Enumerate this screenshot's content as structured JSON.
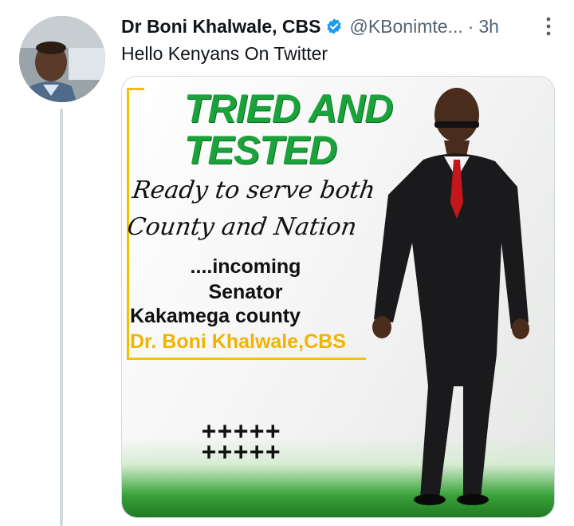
{
  "tweet": {
    "author_name": "Dr Boni Khalwale, CBS",
    "handle": "@KBonimte...",
    "separator": "·",
    "time": "3h",
    "text": "Hello Kenyans On Twitter"
  },
  "poster": {
    "headline_line1": "TRIED AND",
    "headline_line2": "TESTED",
    "script_line1": "Ready to serve both",
    "script_line2": "County and Nation",
    "incoming_line1": "....incoming",
    "incoming_line2": "Senator",
    "county": "Kakamega county",
    "name": "Dr. Boni Khalwale,CBS",
    "crosses_row1": "+++++",
    "crosses_row2": "+++++"
  },
  "colors": {
    "verified_blue": "#1d9bf0",
    "headline_green": "#1aa33a",
    "accent_yellow": "#f2b300",
    "muted_text": "#536471",
    "thread_line": "#cfd9de"
  },
  "icons": {
    "verified": "verified-badge-icon",
    "more": "more-options-icon"
  }
}
